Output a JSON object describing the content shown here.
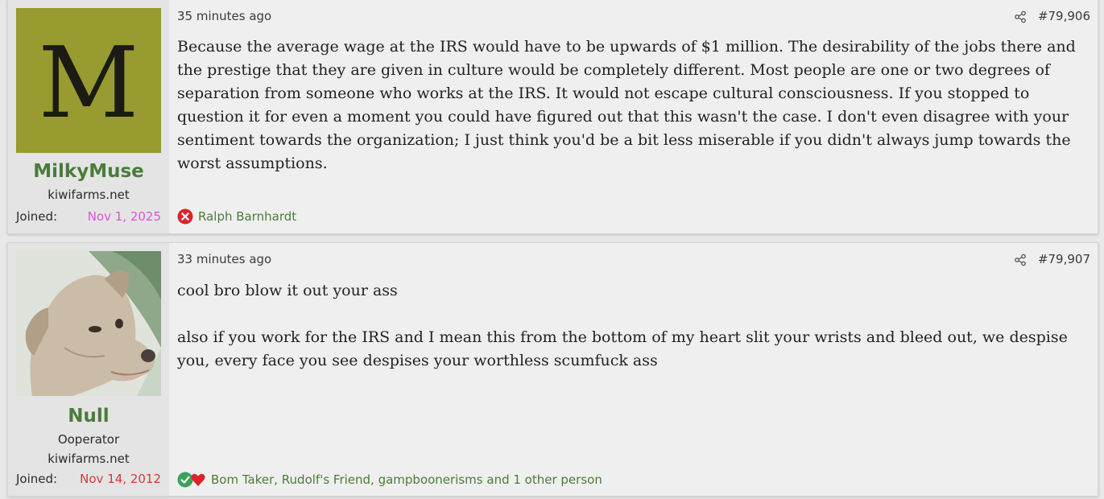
{
  "posts": [
    {
      "avatar_letter": "M",
      "avatar_color": "#979b30",
      "username": "MilkyMuse",
      "user_lines": [
        "kiwifarms.net"
      ],
      "joined_label": "Joined:",
      "joined_date": "Nov 1, 2025",
      "time": "35 minutes ago",
      "post_number": "#79,906",
      "paragraphs": [
        "Because the average wage at the IRS would have to be upwards of $1 million. The desirability of the jobs there and the prestige that they are given in culture would be completely different. Most people are one or two degrees of separation from someone who works at the IRS. It would not escape cultural consciousness. If you stopped to question it for even a moment you could have figured out that this wasn't the case. I don't even disagree with your sentiment towards the organization; I just think you'd be a bit less miserable if you didn't always jump towards the worst assumptions."
      ],
      "reaction_icons": [
        "x-mark-icon"
      ],
      "reactions_text": "Ralph Barnhardt"
    },
    {
      "username": "Null",
      "user_lines": [
        "Ooperator",
        "kiwifarms.net"
      ],
      "joined_label": "Joined:",
      "joined_date": "Nov 14, 2012",
      "time": "33 minutes ago",
      "post_number": "#79,907",
      "paragraphs": [
        "cool bro blow it out your ass",
        "also if you work for the IRS and I mean this from the bottom of my heart slit your wrists and bleed out, we despise you, every face you see despises your worthless scumfuck ass"
      ],
      "reaction_icons": [
        "check-mark-icon",
        "heart-icon"
      ],
      "reactions_text": "Bom Taker, Rudolf's Friend, gampboonerisms and 1 other person"
    }
  ]
}
